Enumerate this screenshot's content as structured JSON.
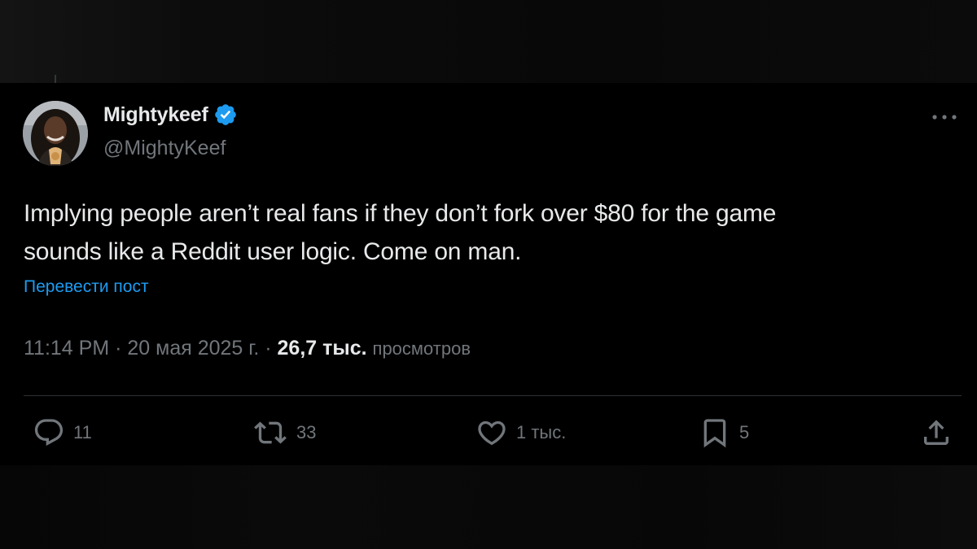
{
  "author": {
    "display_name": "Mightykeef",
    "handle": "@MightyKeef",
    "verified": true
  },
  "tweet": {
    "text_line1": "Implying people aren’t real fans if they don’t fork over $80 for the game",
    "text_line2": "sounds like a Reddit user logic. Come on man.",
    "translate_label": "Перевести пост"
  },
  "meta": {
    "time": "11:14 PM",
    "separator": "·",
    "date": "20 мая 2025 г.",
    "views_count": "26,7 тыс.",
    "views_label": "просмотров"
  },
  "actions": {
    "replies": "11",
    "reposts": "33",
    "likes": "1 тыс.",
    "bookmarks": "5"
  },
  "icons": {
    "verified": "verified-badge-icon",
    "more": "more-dots-icon",
    "reply": "reply-icon",
    "repost": "repost-icon",
    "like": "heart-icon",
    "bookmark": "bookmark-icon",
    "share": "share-icon"
  },
  "colors": {
    "background": "#000000",
    "text": "#e7e9ea",
    "muted": "#71767b",
    "accent": "#1d9bf0"
  }
}
